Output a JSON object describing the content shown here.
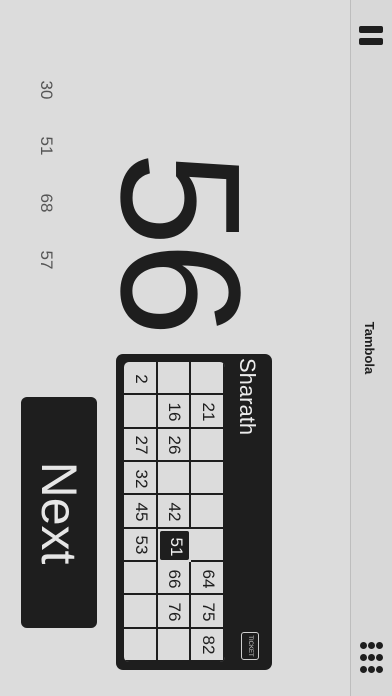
{
  "app": {
    "title": "Tambola"
  },
  "current_number": "56",
  "recent_numbers": [
    "30",
    "51",
    "68",
    "57"
  ],
  "next_button": {
    "label": "Next"
  },
  "ticket": {
    "player_name": "Sharath",
    "icon_label": "TICKET",
    "columns": [
      [
        "",
        "",
        "2"
      ],
      [
        "21",
        "16",
        ""
      ],
      [
        "",
        "26",
        "27"
      ],
      [
        "",
        "",
        "32"
      ],
      [
        "",
        "42",
        "45"
      ],
      [
        "",
        "51",
        "53"
      ],
      [
        "64",
        "66",
        ""
      ],
      [
        "75",
        "76",
        ""
      ],
      [
        "82",
        "",
        ""
      ]
    ],
    "marked": [
      "51"
    ]
  }
}
